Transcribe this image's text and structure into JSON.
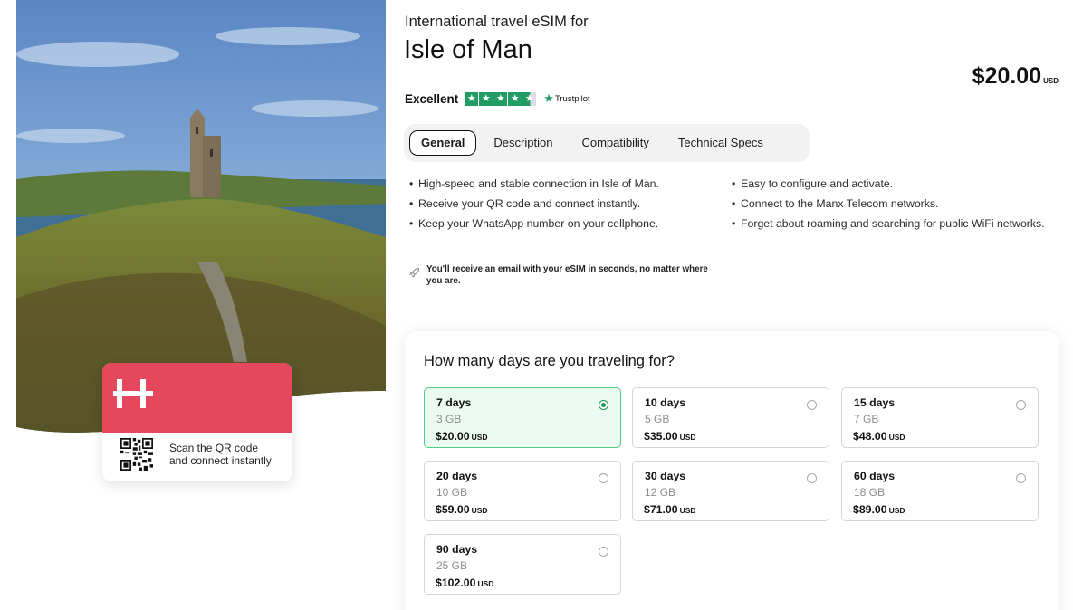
{
  "promo": {
    "qr_text": "Scan the QR code and connect instantly"
  },
  "header": {
    "subtitle": "International travel eSIM for",
    "title": "Isle of Man",
    "price": "$20.00",
    "currency": "USD"
  },
  "rating": {
    "label": "Excellent",
    "stars": 4.5,
    "provider": "Trustpilot"
  },
  "tabs": [
    {
      "label": "General",
      "active": true
    },
    {
      "label": "Description",
      "active": false
    },
    {
      "label": "Compatibility",
      "active": false
    },
    {
      "label": "Technical Specs",
      "active": false
    }
  ],
  "features": {
    "left": [
      "High-speed and stable connection in Isle of Man.",
      "Receive your QR code and connect instantly.",
      "Keep your WhatsApp number on your cellphone."
    ],
    "right": [
      "Easy to configure and activate.",
      "Connect to the Manx Telecom networks.",
      "Forget about roaming and searching for public WiFi networks."
    ]
  },
  "note": "You'll receive an email with your eSIM in seconds, no matter where you are.",
  "plans": {
    "title": "How many days are you traveling for?",
    "currency": "USD",
    "items": [
      {
        "days": "7 days",
        "data": "3 GB",
        "price": "$20.00",
        "selected": true
      },
      {
        "days": "10 days",
        "data": "5 GB",
        "price": "$35.00",
        "selected": false
      },
      {
        "days": "15 days",
        "data": "7 GB",
        "price": "$48.00",
        "selected": false
      },
      {
        "days": "20 days",
        "data": "10 GB",
        "price": "$59.00",
        "selected": false
      },
      {
        "days": "30 days",
        "data": "12 GB",
        "price": "$71.00",
        "selected": false
      },
      {
        "days": "60 days",
        "data": "18 GB",
        "price": "$89.00",
        "selected": false
      },
      {
        "days": "90 days",
        "data": "25 GB",
        "price": "$102.00",
        "selected": false
      }
    ]
  },
  "colors": {
    "brand": "#e5475d",
    "selected_border": "#4fcc7e",
    "selected_bg": "#ecfbf1",
    "trustpilot": "#219c62"
  }
}
